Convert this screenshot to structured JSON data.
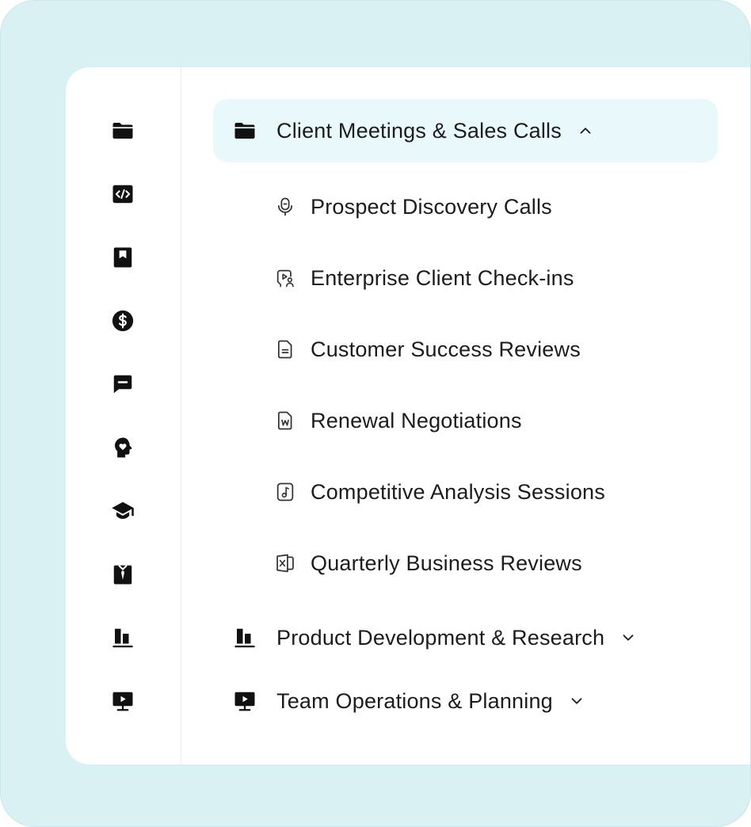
{
  "rail": [
    {
      "icon": "folder-icon"
    },
    {
      "icon": "code-icon"
    },
    {
      "icon": "bookmark-icon"
    },
    {
      "icon": "dollar-icon"
    },
    {
      "icon": "message-icon"
    },
    {
      "icon": "head-heart-icon"
    },
    {
      "icon": "graduation-cap-icon"
    },
    {
      "icon": "shirt-icon"
    },
    {
      "icon": "chart-icon"
    },
    {
      "icon": "presentation-icon"
    }
  ],
  "groups": [
    {
      "label": "Client Meetings & Sales Calls",
      "icon": "folder-icon",
      "expanded": true,
      "items": [
        {
          "label": "Prospect Discovery Calls",
          "icon": "microphone-icon"
        },
        {
          "label": "Enterprise Client Check-ins",
          "icon": "video-chat-icon"
        },
        {
          "label": "Customer Success Reviews",
          "icon": "document-icon"
        },
        {
          "label": "Renewal Negotiations",
          "icon": "word-file-icon"
        },
        {
          "label": "Competitive Analysis Sessions",
          "icon": "audio-file-icon"
        },
        {
          "label": "Quarterly Business Reviews",
          "icon": "excel-file-icon"
        }
      ]
    },
    {
      "label": "Product Development & Research",
      "icon": "chart-icon",
      "expanded": false
    },
    {
      "label": "Team Operations & Planning",
      "icon": "presentation-icon",
      "expanded": false
    }
  ],
  "colors": {
    "background": "#daf1f4",
    "active_row": "#e9f9fb",
    "text": "#1c1c1c",
    "icon": "#111111"
  }
}
